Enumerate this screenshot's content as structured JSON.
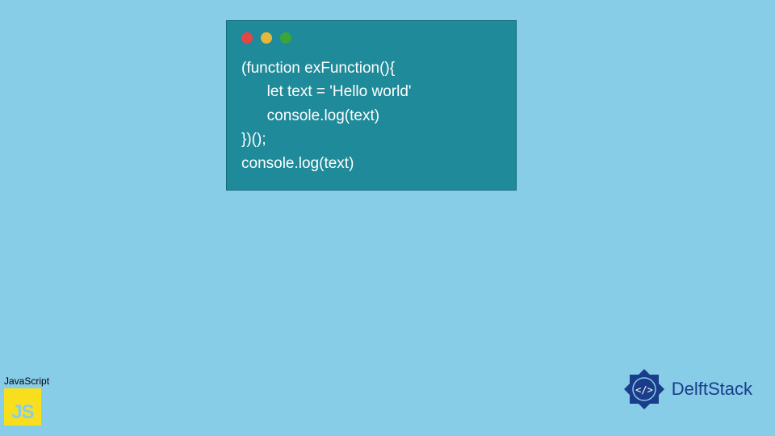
{
  "code": {
    "lines": [
      "(function exFunction(){",
      "      let text = 'Hello world'",
      "      console.log(text)",
      "})();",
      "console.log(text)"
    ]
  },
  "js_badge": {
    "label": "JavaScript",
    "logo_text": "JS"
  },
  "brand": {
    "name": "DelftStack"
  }
}
